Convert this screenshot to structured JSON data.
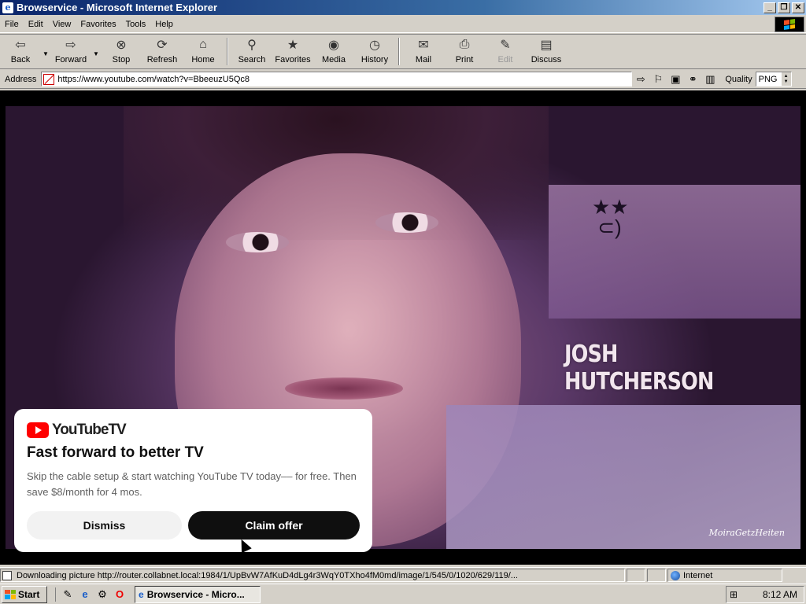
{
  "window": {
    "title": "Browservice - Microsoft Internet Explorer",
    "buttons": [
      "_",
      "❐",
      "✕"
    ]
  },
  "menubar": {
    "items": [
      "File",
      "Edit",
      "View",
      "Favorites",
      "Tools",
      "Help"
    ]
  },
  "toolbar": {
    "back": "Back",
    "forward": "Forward",
    "stop": "Stop",
    "refresh": "Refresh",
    "home": "Home",
    "search": "Search",
    "favorites": "Favorites",
    "media": "Media",
    "history": "History",
    "mail": "Mail",
    "print": "Print",
    "edit": "Edit",
    "discuss": "Discuss"
  },
  "addressbar": {
    "label": "Address",
    "url": "https://www.youtube.com/watch?v=BbeeuzU5Qc8",
    "quality_label": "Quality",
    "quality_value": "PNG"
  },
  "video": {
    "overlay_text": "JOSH HUTCHERSON",
    "watermark": "MoiraGetzHeiten"
  },
  "promo": {
    "brand": "YouTubeTV",
    "headline": "Fast forward to better TV",
    "body": "Skip the cable setup & start watching YouTube TV today–– for free. Then save $8/month for 4 mos.",
    "dismiss": "Dismiss",
    "claim": "Claim offer"
  },
  "statusbar": {
    "text": "Downloading picture http://router.collabnet.local:1984/1/UpBvW7AfKuD4dLg4r3WqY0TXho4fM0md/image/1/545/0/1020/629/119/...",
    "zone": "Internet"
  },
  "taskbar": {
    "start": "Start",
    "task": "Browservice - Micro...",
    "clock": "8:12 AM"
  },
  "colors": {
    "titlebar": "#0a246a",
    "chrome": "#d4d0c8",
    "youtube_red": "#ff0000",
    "claim_button": "#0f0f0f"
  }
}
